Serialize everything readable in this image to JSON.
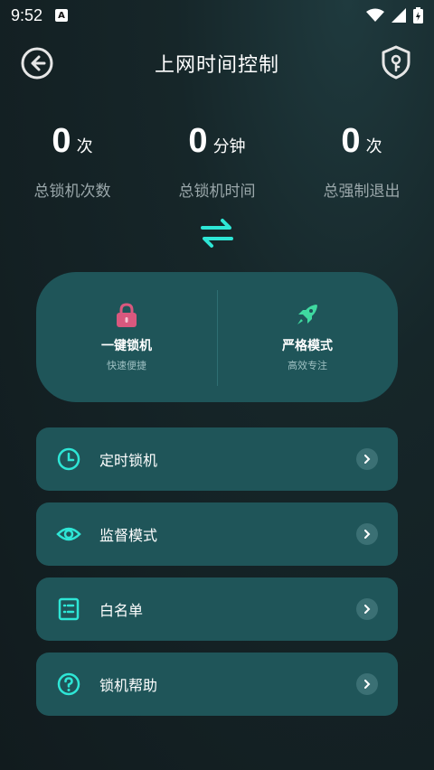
{
  "status_bar": {
    "time": "9:52",
    "notification_glyph": "A"
  },
  "header": {
    "title": "上网时间控制"
  },
  "stats": [
    {
      "value": "0",
      "unit": "次",
      "label": "总锁机次数"
    },
    {
      "value": "0",
      "unit": "分钟",
      "label": "总锁机时间"
    },
    {
      "value": "0",
      "unit": "次",
      "label": "总强制退出"
    }
  ],
  "modes": [
    {
      "title": "一键锁机",
      "subtitle": "快速便捷",
      "icon": "lock-icon"
    },
    {
      "title": "严格模式",
      "subtitle": "高效专注",
      "icon": "rocket-icon"
    }
  ],
  "menu": [
    {
      "label": "定时锁机",
      "icon": "clock-icon"
    },
    {
      "label": "监督模式",
      "icon": "eye-icon"
    },
    {
      "label": "白名单",
      "icon": "list-icon"
    },
    {
      "label": "锁机帮助",
      "icon": "help-icon"
    }
  ],
  "colors": {
    "accent": "#2ee6d6",
    "card": "#1f5559",
    "lock": "#d9587e",
    "rocket": "#3fd9a0"
  }
}
